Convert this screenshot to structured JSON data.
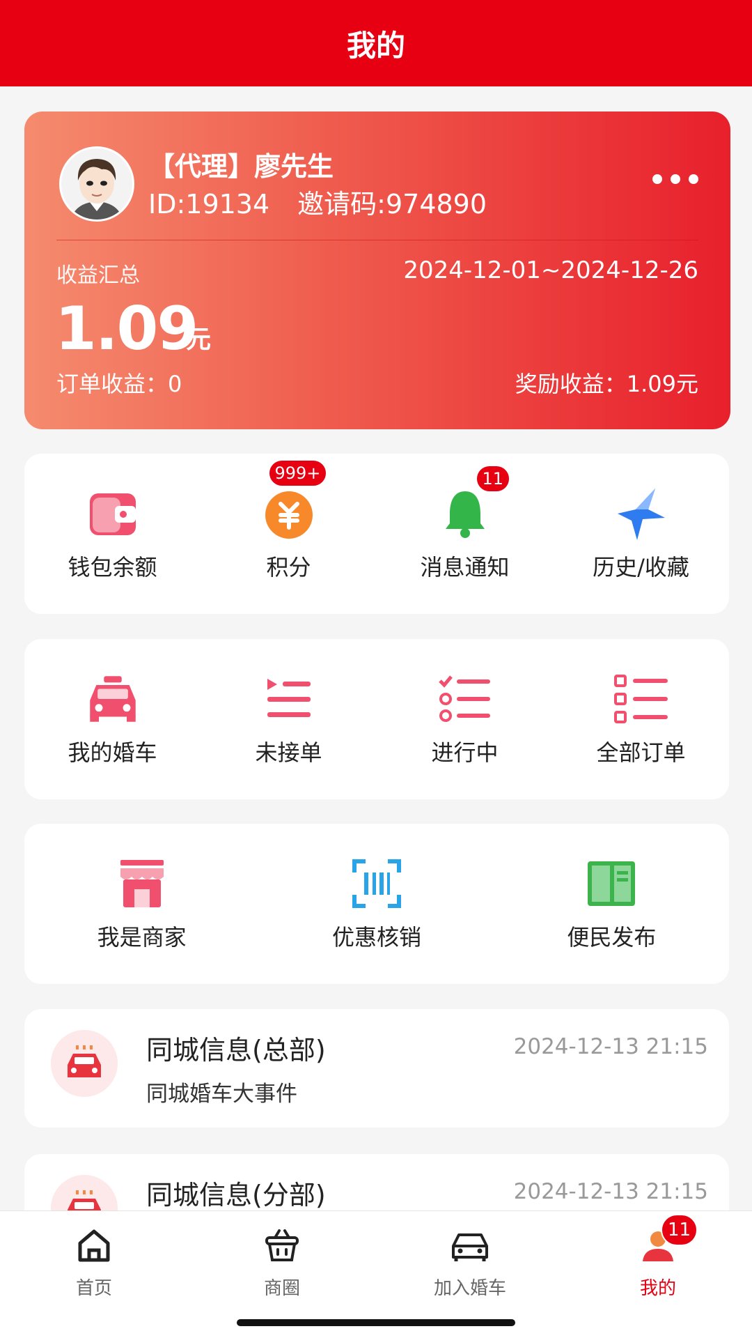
{
  "header": {
    "title": "我的"
  },
  "profile": {
    "name": "【代理】廖先生",
    "id_text": "ID:19134",
    "invite_text": "邀请码:974890",
    "earnings_title": "收益汇总",
    "date_range": "2024-12-01~2024-12-26",
    "total_amount": "1.09",
    "unit": "元",
    "order_earnings": "订单收益：0",
    "reward_earnings": "奖励收益：1.09元"
  },
  "quick": [
    {
      "label": "钱包余额",
      "icon": "wallet-icon",
      "color": "#f0506e"
    },
    {
      "label": "积分",
      "icon": "points-coin-icon",
      "color": "#f7892b",
      "badge": "999+"
    },
    {
      "label": "消息通知",
      "icon": "bell-icon",
      "color": "#33b54a",
      "badge": "11"
    },
    {
      "label": "历史/收藏",
      "icon": "star-icon",
      "color": "#2f7bf0"
    }
  ],
  "orders": [
    {
      "label": "我的婚车",
      "icon": "car-icon"
    },
    {
      "label": "未接单",
      "icon": "pending-list-icon"
    },
    {
      "label": "进行中",
      "icon": "checklist-icon"
    },
    {
      "label": "全部订单",
      "icon": "all-orders-icon"
    }
  ],
  "services": [
    {
      "label": "我是商家",
      "icon": "store-icon",
      "color": "#f0506e"
    },
    {
      "label": "优惠核销",
      "icon": "scan-icon",
      "color": "#2aa4e8"
    },
    {
      "label": "便民发布",
      "icon": "publish-icon",
      "color": "#3cb44b"
    }
  ],
  "info": [
    {
      "title": "同城信息(总部)",
      "time": "2024-12-13 21:15",
      "subtitle": "同城婚车大事件"
    },
    {
      "title": "同城信息(分部)",
      "time": "2024-12-13 21:15"
    }
  ],
  "tabs": [
    {
      "label": "首页",
      "icon": "home-icon"
    },
    {
      "label": "商圈",
      "icon": "basket-icon"
    },
    {
      "label": "加入婚车",
      "icon": "car-tab-icon"
    },
    {
      "label": "我的",
      "icon": "user-icon",
      "badge": "11",
      "active": true
    }
  ]
}
